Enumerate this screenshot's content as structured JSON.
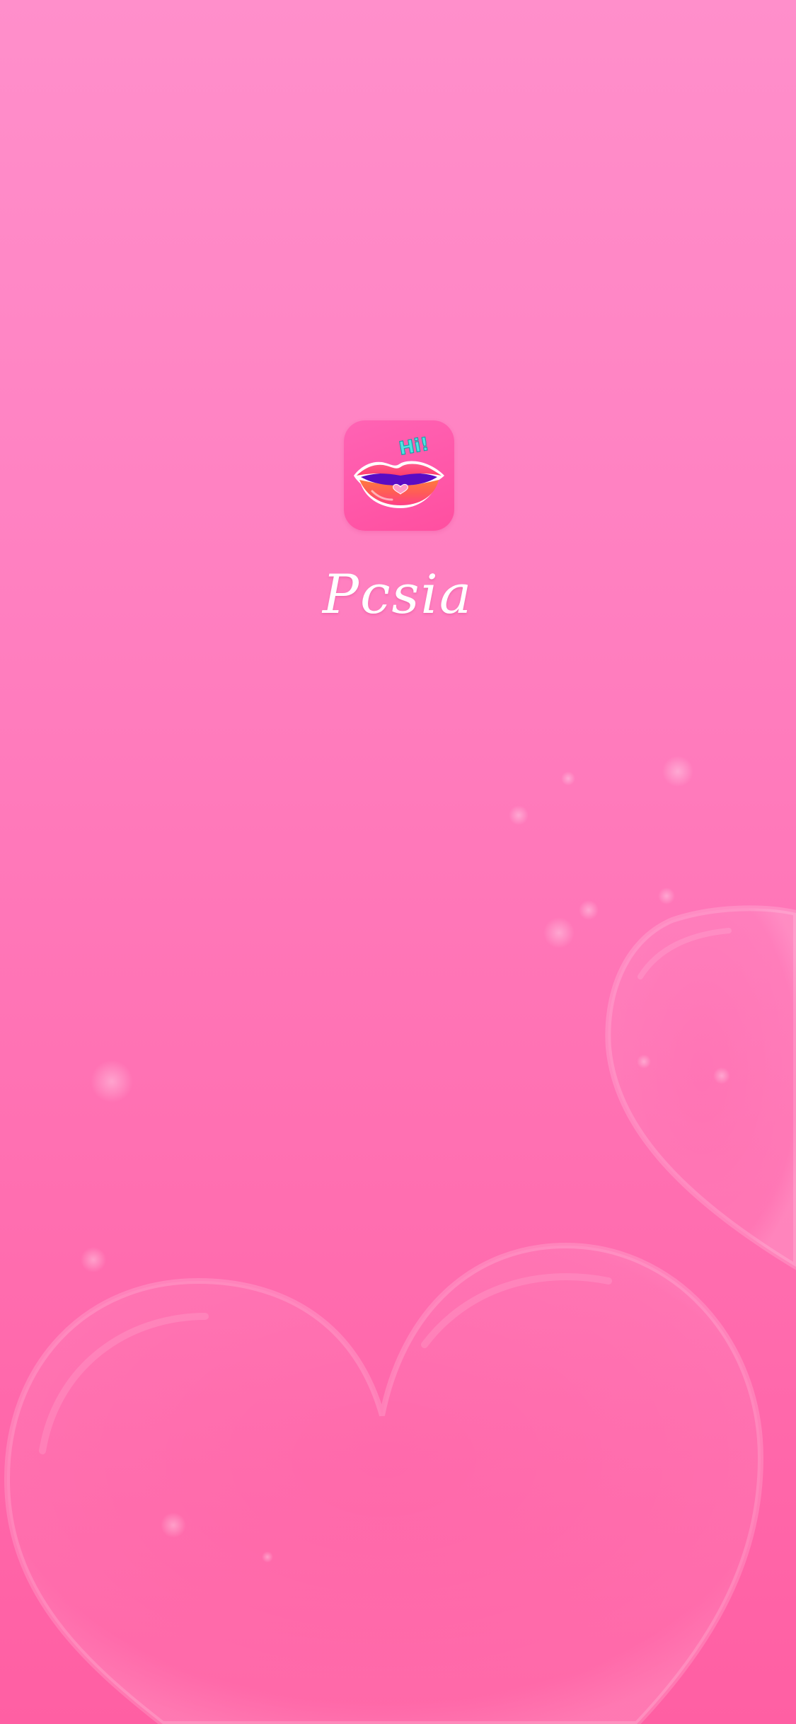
{
  "splash": {
    "app_name": "Pcsia",
    "icon": {
      "name": "lips-logo-icon",
      "badge_text": "Hi!"
    }
  },
  "background": {
    "decoration": "heart-bubbles",
    "gradient_top": "#ff8fcb",
    "gradient_bottom": "#ff5fa3"
  },
  "colors": {
    "icon_bg": "#ff4fa0",
    "badge": "#4fe3e0",
    "text": "#ffffff"
  }
}
